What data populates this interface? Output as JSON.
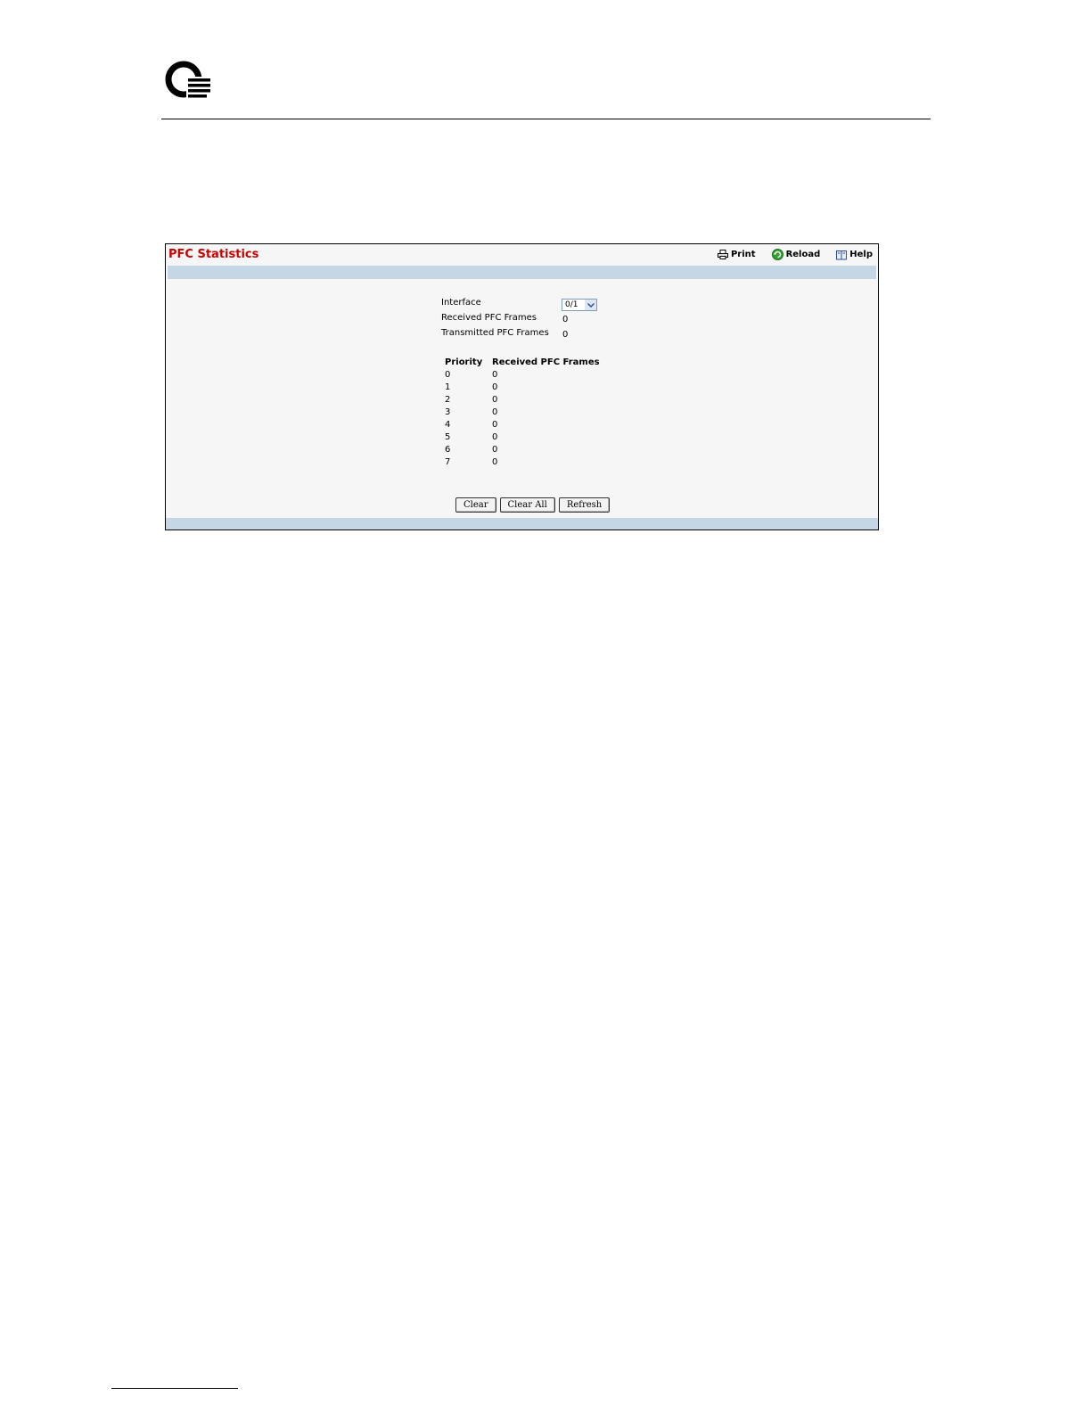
{
  "panel": {
    "title": "PFC Statistics",
    "toolbar": {
      "print_label": "Print",
      "reload_label": "Reload",
      "help_label": "Help"
    }
  },
  "form": {
    "interface_label": "Interface",
    "interface_value": "0/1",
    "received_label": "Received PFC Frames",
    "received_value": "0",
    "transmitted_label": "Transmitted PFC Frames",
    "transmitted_value": "0"
  },
  "priority_table": {
    "headers": [
      "Priority",
      "Received PFC Frames"
    ],
    "rows": [
      [
        "0",
        "0"
      ],
      [
        "1",
        "0"
      ],
      [
        "2",
        "0"
      ],
      [
        "3",
        "0"
      ],
      [
        "4",
        "0"
      ],
      [
        "5",
        "0"
      ],
      [
        "6",
        "0"
      ],
      [
        "7",
        "0"
      ]
    ]
  },
  "buttons": {
    "clear_label": "Clear",
    "clear_all_label": "Clear All",
    "refresh_label": "Refresh"
  },
  "colors": {
    "title": "#cc0000",
    "band": "#c5d6e4",
    "panel_bg": "#f6f6f6"
  }
}
